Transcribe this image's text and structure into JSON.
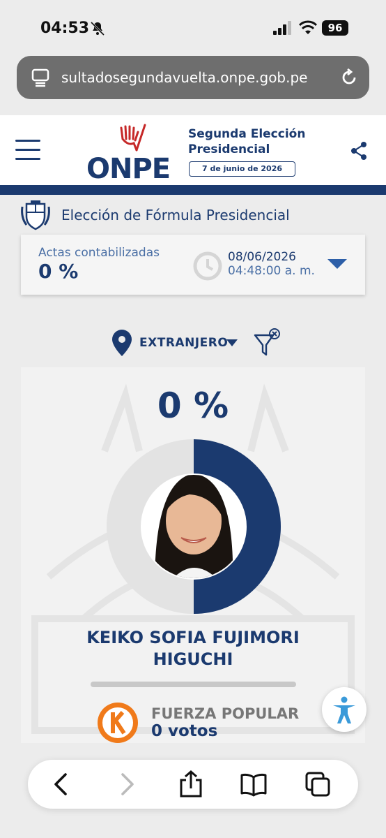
{
  "status_bar": {
    "time": "04:53",
    "battery": "96"
  },
  "browser": {
    "url": "sultadosegundavuelta.onpe.gob.pe"
  },
  "header": {
    "logo": "ONPE",
    "title_line1": "Segunda Elección",
    "title_line2": "Presidencial",
    "date": "7 de junio de 2026"
  },
  "section": {
    "title": "Elección de Fórmula Presidencial"
  },
  "actas": {
    "label": "Actas contabilizadas",
    "percent": "0 %",
    "date": "08/06/2026",
    "time": "04:48:00 a. m."
  },
  "location": {
    "selected": "EXTRANJERO"
  },
  "candidate": {
    "percent": "0 %",
    "share": 0.5,
    "name_line1": "KEIKO SOFIA FUJIMORI",
    "name_line2": "HIGUCHI",
    "progress": 0,
    "party": "FUERZA POPULAR",
    "votes": "0 votos",
    "colors": {
      "primary": "#1b3a6f",
      "track": "#e3e3e3"
    }
  },
  "toolbar": {
    "icons": [
      "back-icon",
      "forward-icon",
      "share-icon",
      "bookmarks-icon",
      "tabs-icon"
    ]
  }
}
